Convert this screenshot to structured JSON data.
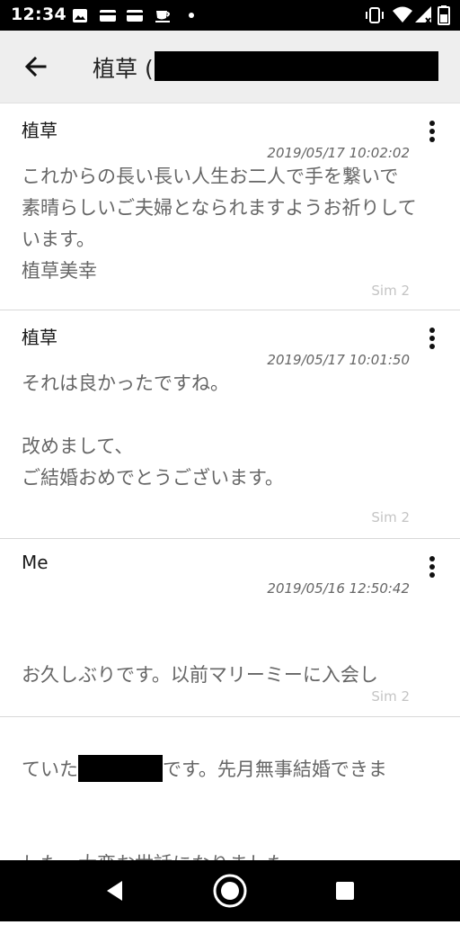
{
  "status_bar": {
    "time": "12:34",
    "icons": [
      "image-icon",
      "card-icon",
      "card-icon",
      "cup-icon",
      "dot-icon",
      "vibrate-icon",
      "wifi-icon",
      "signal-icon",
      "battery-icon"
    ]
  },
  "app_bar": {
    "title": "植草 (",
    "back_icon": "arrow-back-icon"
  },
  "messages": [
    {
      "sender": "植草",
      "timestamp": "2019/05/17 10:02:02",
      "body": "これからの長い長い人生お二人で手を繋いで素晴らしいご夫婦となられますようお祈りしています。\n植草美幸",
      "sim": "Sim 2"
    },
    {
      "sender": "植草",
      "timestamp": "2019/05/17 10:01:50",
      "body": "それは良かったですね。\n\n改めまして、\nご結婚おめでとうございます。",
      "sim": "Sim 2"
    },
    {
      "sender": "Me",
      "timestamp": "2019/05/16 12:50:42",
      "body_line1": "お久しぶりです。以前マリーミーに入会し",
      "body_line2a": "ていた",
      "body_line2b": "です。先月無事結婚できま",
      "body_line3": "した。大変お世話になりました。",
      "sim": "Sim 2"
    }
  ],
  "nav_bar": {
    "icons": [
      "back-triangle-icon",
      "home-circle-icon",
      "recents-square-icon"
    ]
  },
  "colors": {
    "status_bar": "#000000",
    "app_bar": "#eeeeee",
    "body_text": "#666666",
    "timestamp": "#666666",
    "sim_label": "#c4c4c4",
    "divider": "#d8d8d8"
  }
}
